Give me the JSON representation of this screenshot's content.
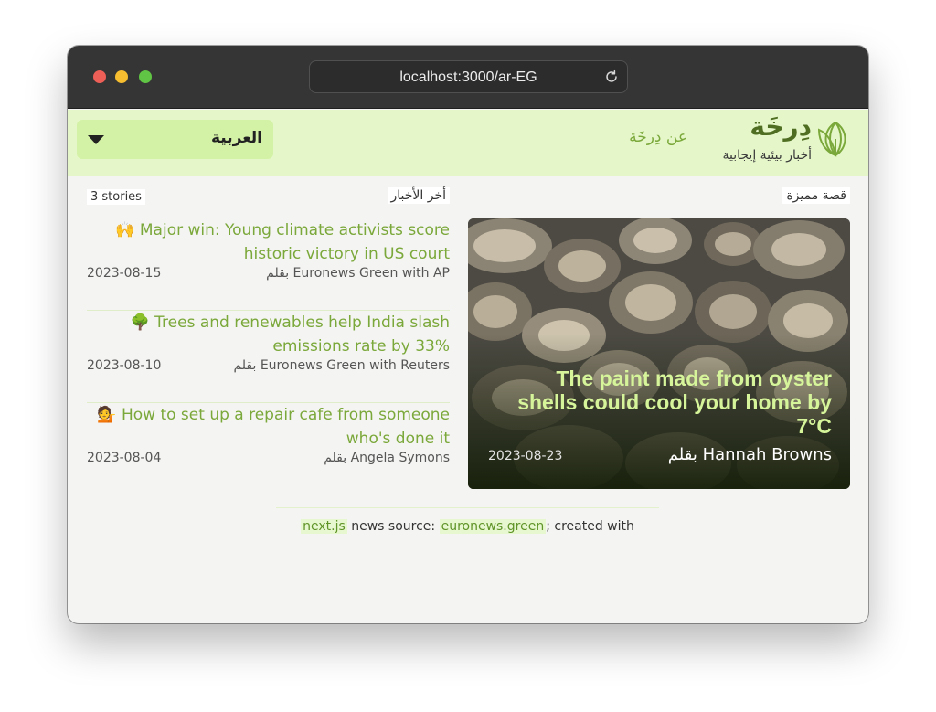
{
  "browser": {
    "url": "localhost:3000/ar-EG"
  },
  "header": {
    "logo_title": "دِرخَة",
    "logo_tagline": "أخبار بيئية إيجابية",
    "about_link": "عن دِرخَة",
    "language": {
      "selected": "العربية"
    },
    "accent_color": "#7ba83a",
    "background_color": "#e5f7c9"
  },
  "featured": {
    "section_label": "قصة مميزة",
    "title": "The paint made from oyster shells could cool your home by 7°C",
    "author": "بقلم Hannah Browns",
    "date": "2023-08-23"
  },
  "latest": {
    "section_label": "أخر الأخبار",
    "count_label": "3 stories",
    "stories": [
      {
        "title": "Major win: Young climate activists score historic victory in US court",
        "emoji": "🙌",
        "author": "بقلم Euronews Green with AP",
        "date": "2023-08-15"
      },
      {
        "title": "Trees and renewables help India slash emissions rate by 33%",
        "emoji": "🌳",
        "author": "بقلم Euronews Green with Reuters",
        "date": "2023-08-10"
      },
      {
        "title": "How to set up a repair cafe from someone who's done it",
        "emoji": "💁",
        "author": "بقلم Angela Symons",
        "date": "2023-08-04"
      }
    ]
  },
  "footer": {
    "created_with_prefix": "created with",
    "framework_link": "next.js",
    "source_prefix": "news source:",
    "source_link": "euronews.green"
  }
}
